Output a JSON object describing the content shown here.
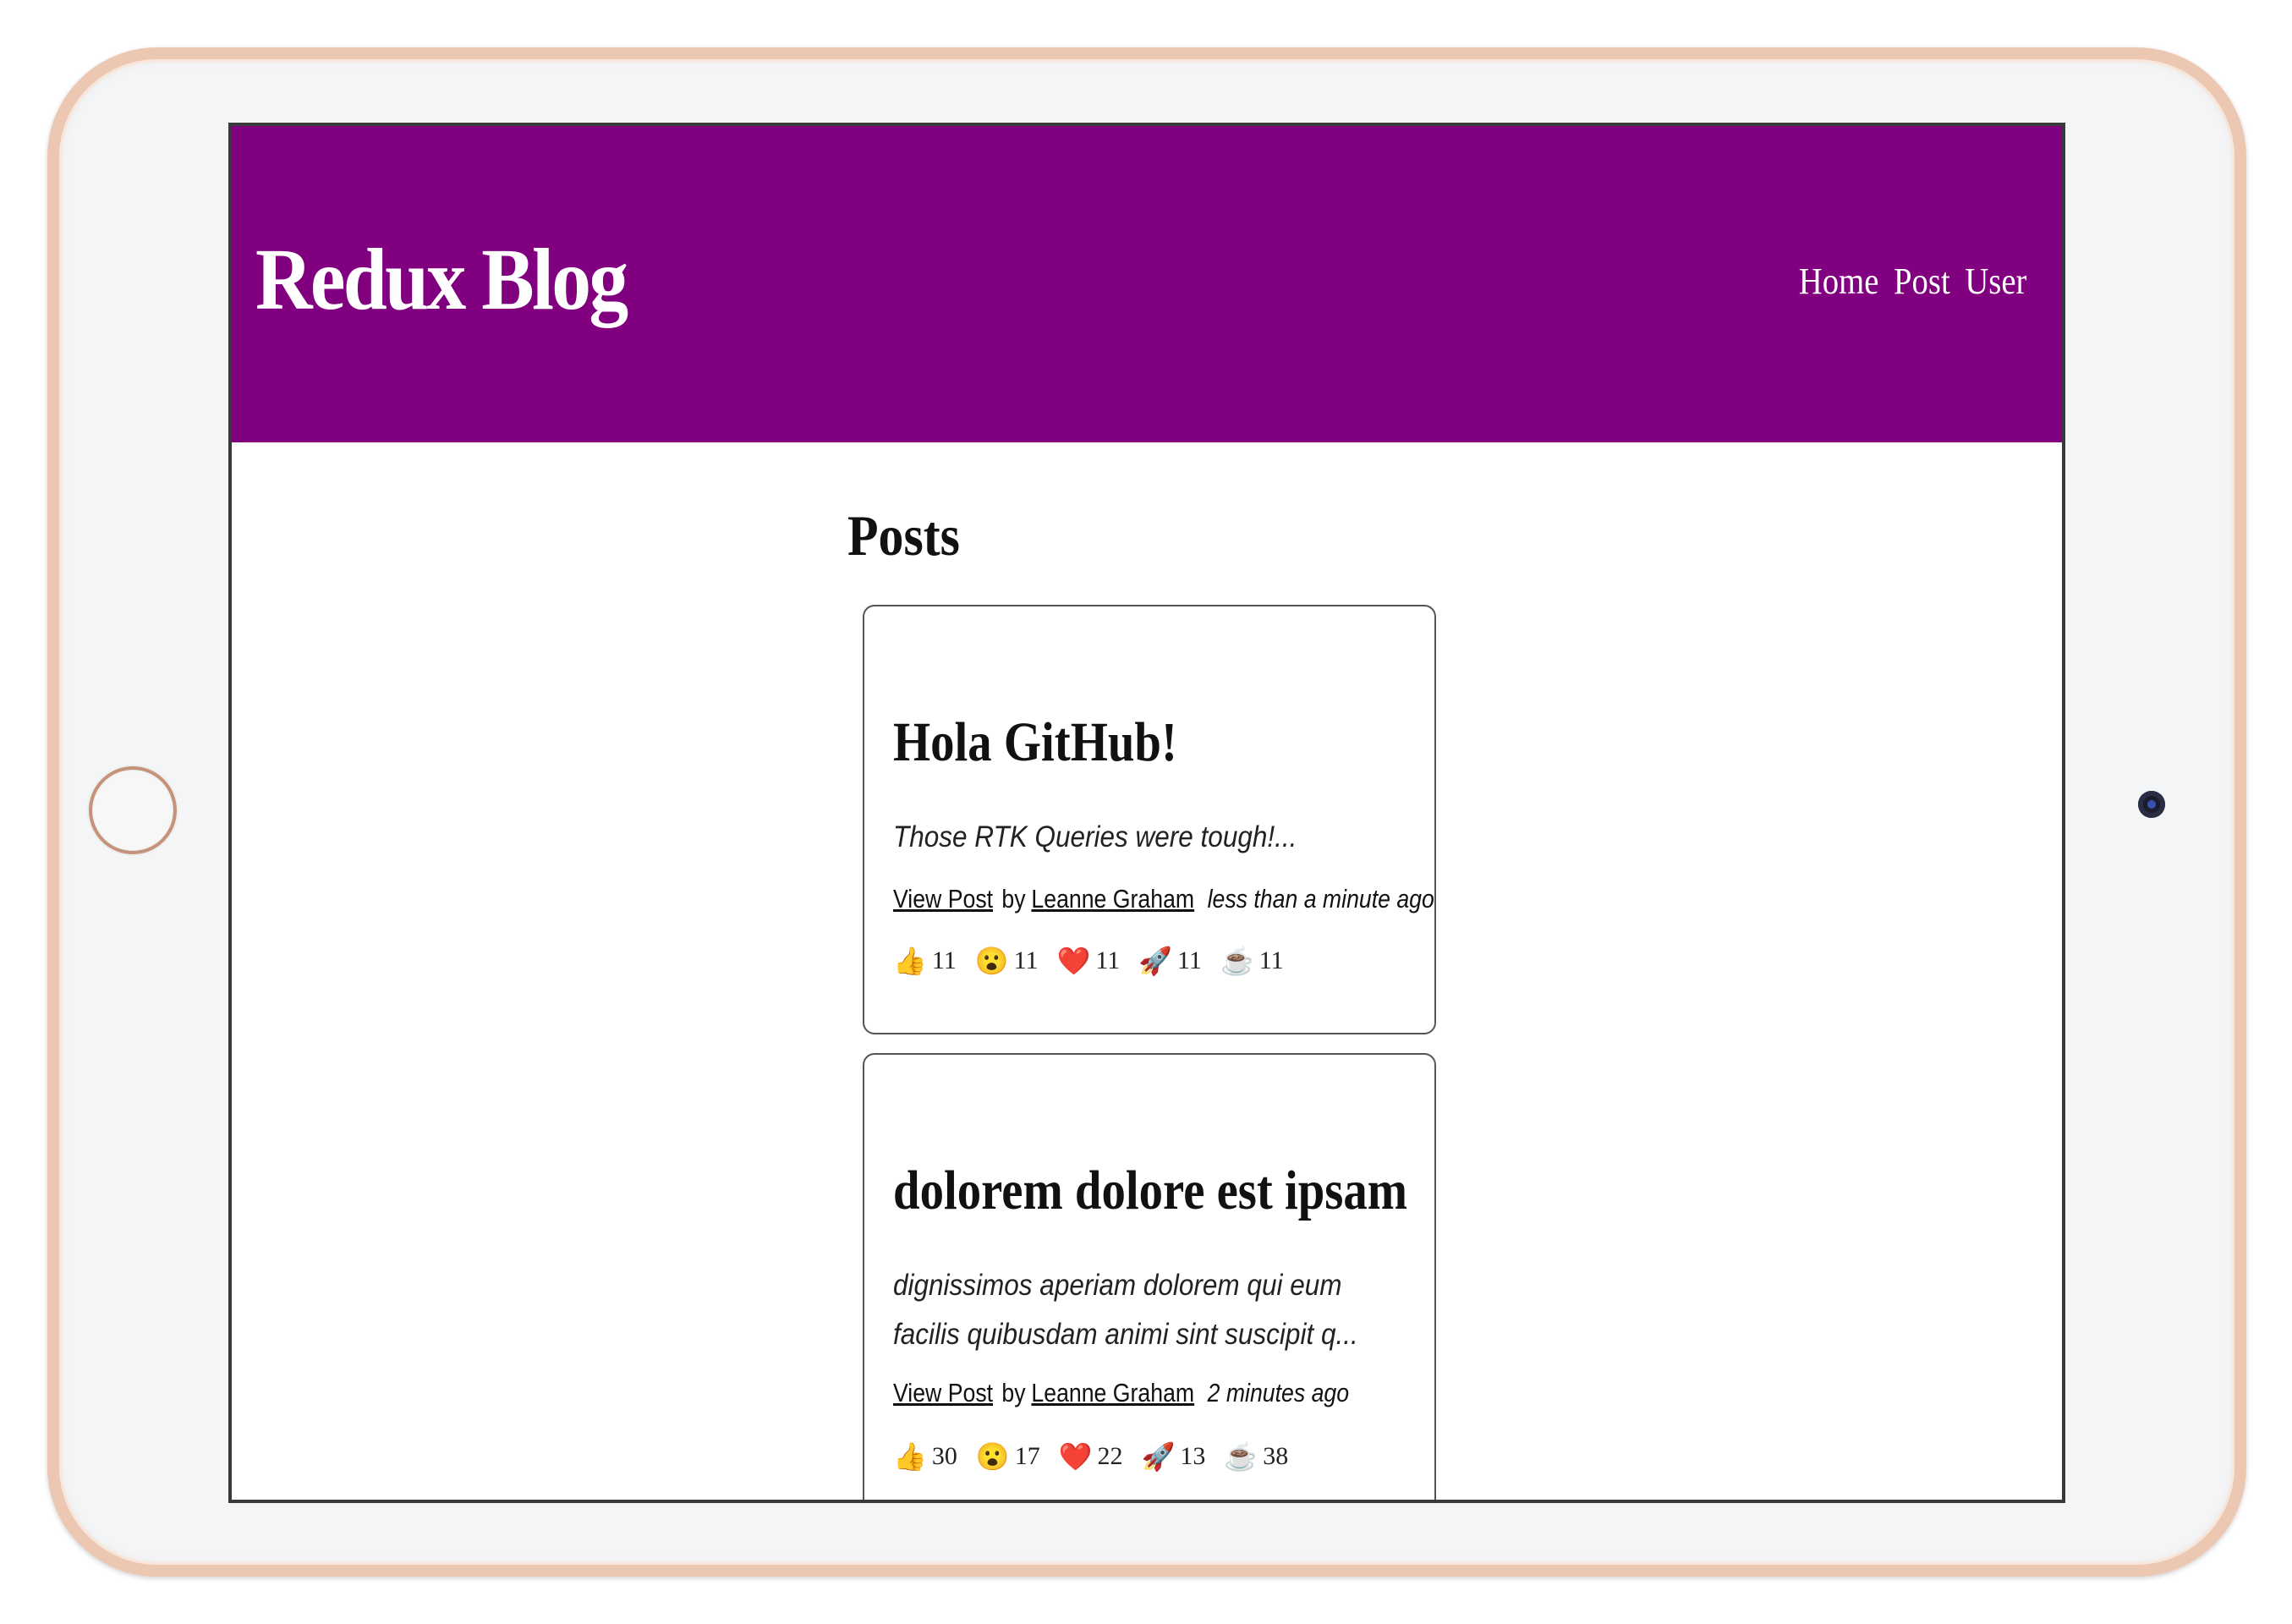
{
  "header": {
    "brand": "Redux Blog",
    "nav": {
      "home": "Home",
      "post": "Post",
      "user": "User"
    }
  },
  "main": {
    "title": "Posts",
    "posts": [
      {
        "title": "Hola GitHub!",
        "excerpt": "Those RTK Queries were tough!...",
        "view_label": "View Post",
        "by_label": "by",
        "author": "Leanne Graham",
        "time": "less than a minute ago",
        "reactions": [
          {
            "icon": "thumbs-up",
            "emoji": "👍",
            "count": "11"
          },
          {
            "icon": "wow-face",
            "emoji": "😮",
            "count": "11"
          },
          {
            "icon": "heart",
            "emoji": "❤️",
            "count": "11"
          },
          {
            "icon": "rocket",
            "emoji": "🚀",
            "count": "11"
          },
          {
            "icon": "coffee",
            "emoji": "☕",
            "count": "11"
          }
        ]
      },
      {
        "title": "dolorem dolore est ipsam",
        "excerpt": "dignissimos aperiam dolorem qui eum facilis quibusdam animi sint suscipit q...",
        "view_label": "View Post",
        "by_label": "by",
        "author": "Leanne Graham",
        "time": "2 minutes ago",
        "reactions": [
          {
            "icon": "thumbs-up",
            "emoji": "👍",
            "count": "30"
          },
          {
            "icon": "wow-face",
            "emoji": "😮",
            "count": "17"
          },
          {
            "icon": "heart",
            "emoji": "❤️",
            "count": "22"
          },
          {
            "icon": "rocket",
            "emoji": "🚀",
            "count": "13"
          },
          {
            "icon": "coffee",
            "emoji": "☕",
            "count": "38"
          }
        ]
      }
    ]
  },
  "colors": {
    "header_bg": "#800080",
    "tablet_frame": "#ecc7b2"
  }
}
